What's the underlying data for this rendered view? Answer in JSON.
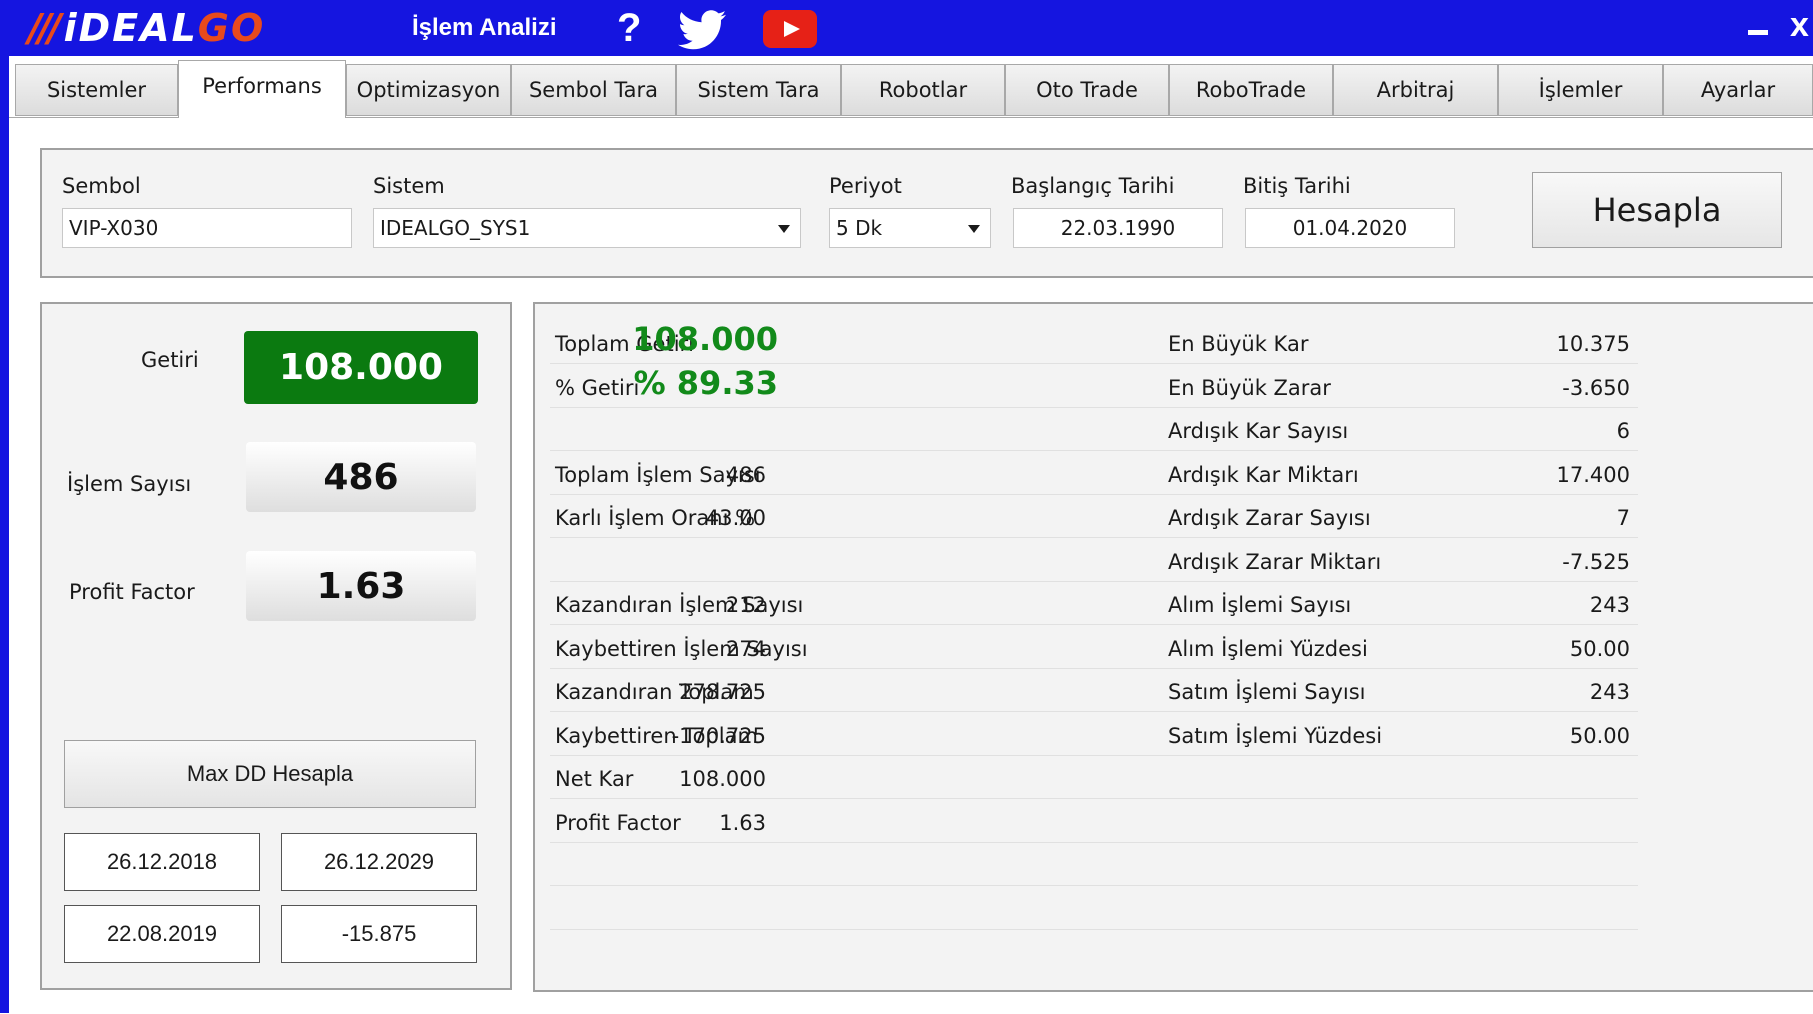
{
  "window": {
    "logo_prefix": "///",
    "logo_main": "iDEAL",
    "logo_go": "GO",
    "title": "İşlem Analizi",
    "help": "?",
    "minimize": "_",
    "close": "x"
  },
  "tabs": [
    {
      "label": "Sistemler"
    },
    {
      "label": "Performans"
    },
    {
      "label": "Optimizasyon"
    },
    {
      "label": "Sembol Tara"
    },
    {
      "label": "Sistem Tara"
    },
    {
      "label": "Robotlar"
    },
    {
      "label": "Oto Trade"
    },
    {
      "label": "RoboTrade"
    },
    {
      "label": "Arbitraj"
    },
    {
      "label": "İşlemler"
    },
    {
      "label": "Ayarlar"
    }
  ],
  "form": {
    "sembol_label": "Sembol",
    "sembol_value": "VIP-X030",
    "sistem_label": "Sistem",
    "sistem_value": "IDEALGO_SYS1",
    "periyot_label": "Periyot",
    "periyot_value": "5 Dk",
    "baslangic_label": "Başlangıç Tarihi",
    "baslangic_value": "22.03.1990",
    "bitis_label": "Bitiş Tarihi",
    "bitis_value": "01.04.2020",
    "hesapla": "Hesapla"
  },
  "summary": {
    "getiri_label": "Getiri",
    "getiri_value": "108.000",
    "islem_label": "İşlem Sayısı",
    "islem_value": "486",
    "pf_label": "Profit Factor",
    "pf_value": "1.63",
    "maxdd_button": "Max DD Hesapla",
    "dd_date1": "26.12.2018",
    "dd_date2": "26.12.2029",
    "dd_date3": "22.08.2019",
    "dd_value": "-15.875"
  },
  "stats_left": [
    {
      "label": "Toplam Getiri",
      "value": "108.000"
    },
    {
      "label": "% Getiri",
      "value": "%  89.33"
    },
    {
      "label": "",
      "value": ""
    },
    {
      "label": "Toplam İşlem Sayısı",
      "value": "486"
    },
    {
      "label": "Karlı İşlem Oranı %",
      "value": "43.00"
    },
    {
      "label": "",
      "value": ""
    },
    {
      "label": "Kazandıran İşlem Sayısı",
      "value": "212"
    },
    {
      "label": "Kaybettiren İşlem Sayısı",
      "value": "274"
    },
    {
      "label": "Kazandıran Toplam",
      "value": "278.725"
    },
    {
      "label": "Kaybettiren Toplam",
      "value": "-170.725"
    },
    {
      "label": "Net Kar",
      "value": "108.000"
    },
    {
      "label": "Profit Factor",
      "value": "1.63"
    },
    {
      "label": "",
      "value": ""
    },
    {
      "label": "",
      "value": ""
    }
  ],
  "stats_right": [
    {
      "label": "En Büyük Kar",
      "value": "10.375"
    },
    {
      "label": "En Büyük Zarar",
      "value": "-3.650"
    },
    {
      "label": "Ardışık Kar Sayısı",
      "value": "6"
    },
    {
      "label": "Ardışık Kar Miktarı",
      "value": "17.400"
    },
    {
      "label": "Ardışık Zarar Sayısı",
      "value": "7"
    },
    {
      "label": "Ardışık Zarar Miktarı",
      "value": "-7.525"
    },
    {
      "label": "Alım İşlemi Sayısı",
      "value": "243"
    },
    {
      "label": "Alım İşlemi Yüzdesi",
      "value": "50.00"
    },
    {
      "label": "Satım İşlemi Sayısı",
      "value": "243"
    },
    {
      "label": "Satım İşlemi Yüzdesi",
      "value": "50.00"
    },
    {
      "label": "",
      "value": ""
    },
    {
      "label": "",
      "value": ""
    },
    {
      "label": "",
      "value": ""
    },
    {
      "label": "",
      "value": ""
    }
  ],
  "colors": {
    "titlebar": "#1515e0",
    "logo_accent": "#e84a1c",
    "positive_green": "#128a1a",
    "getiri_box": "#0b7a10"
  },
  "icons": [
    "help-icon",
    "twitter-icon",
    "youtube-icon",
    "minimize-icon",
    "close-icon",
    "dropdown-arrow-icon"
  ]
}
